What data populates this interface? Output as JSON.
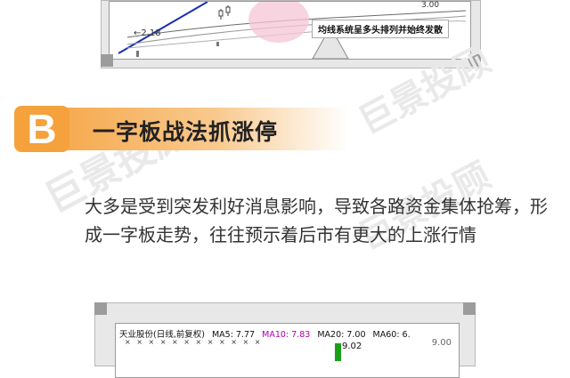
{
  "top_chart": {
    "price_label": "3.00",
    "arrow_label": "←2.18",
    "caption": "均线系统呈多头排列并始终发散"
  },
  "section": {
    "badge": "B",
    "title": "一字板战法抓涨停"
  },
  "watermark": "巨景投顾",
  "paragraph": "大多是受到突发利好消息影响，导致各路资金集体抢筹，形成一字板走势，往往预示着后市有更大的上涨行情",
  "bottom_chart": {
    "stock_name": "天业股份(日线,前复权)",
    "ma5": "MA5: 7.77",
    "ma10": "MA10: 7.83",
    "ma20": "MA20: 7.00",
    "ma60": "MA60: 6.",
    "x_marks": "× ×    × ×   × × × × ×   × ×     ×",
    "price_high": "9.02",
    "price_axis": "9.00"
  },
  "colors": {
    "accent": "#f5a13c",
    "ma10": "#b000b0",
    "candle_up": "#18a018"
  }
}
